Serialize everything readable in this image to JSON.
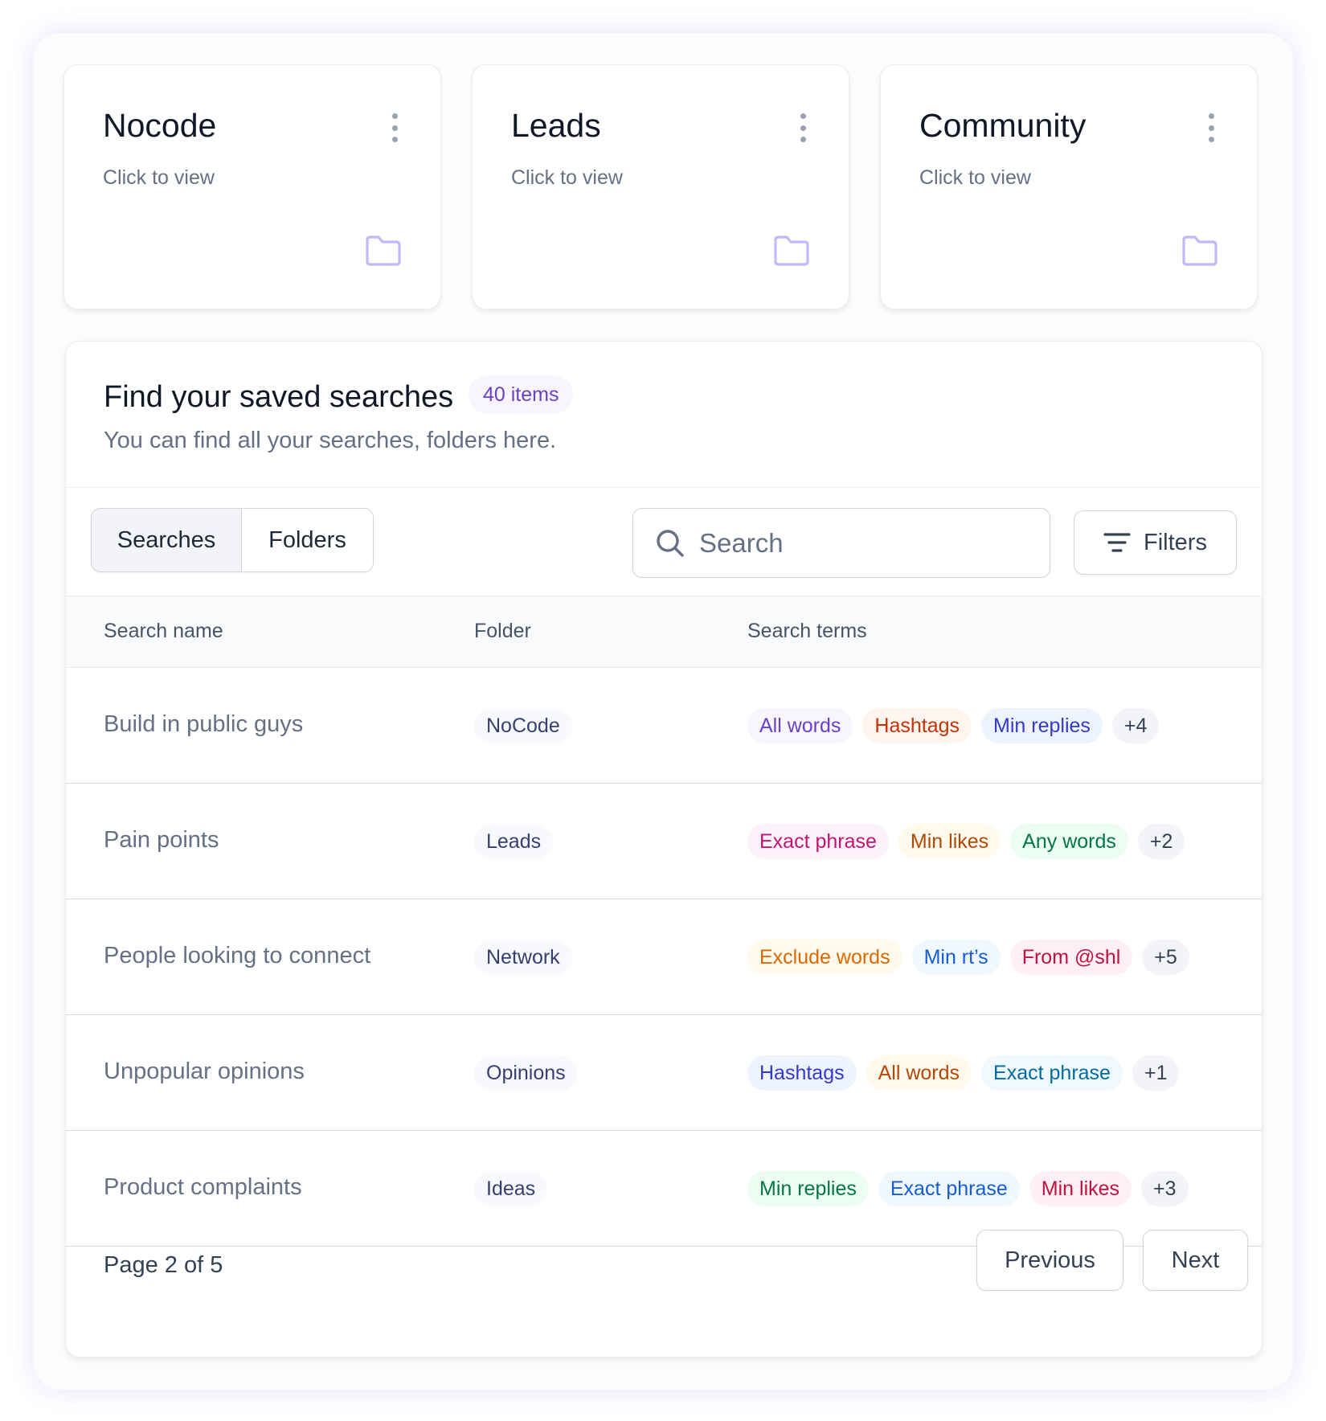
{
  "folders": [
    {
      "title": "Nocode",
      "subtitle": "Click to view"
    },
    {
      "title": "Leads",
      "subtitle": "Click to view"
    },
    {
      "title": "Community",
      "subtitle": "Click to view"
    }
  ],
  "saved": {
    "title": "Find your saved searches",
    "count_badge": "40 items",
    "subtitle": "You can find all your searches, folders here."
  },
  "toolbar": {
    "tabs": [
      "Searches",
      "Folders"
    ],
    "active_tab": "Searches",
    "search_placeholder": "Search",
    "search_value": "",
    "filters_label": "Filters"
  },
  "table": {
    "columns": [
      "Search name",
      "Folder",
      "Search terms"
    ],
    "rows": [
      {
        "name": "Build in public guys",
        "folder": "NoCode",
        "terms": [
          "All words",
          "Hashtags",
          "Min replies"
        ],
        "more": "+4"
      },
      {
        "name": "Pain points",
        "folder": "Leads",
        "terms": [
          "Exact phrase",
          "Min likes",
          "Any words"
        ],
        "more": "+2"
      },
      {
        "name": "People looking to connect",
        "folder": "Network",
        "terms": [
          "Exclude words",
          "Min rt’s",
          "From @shl"
        ],
        "more": "+5"
      },
      {
        "name": "Unpopular opinions",
        "folder": "Opinions",
        "terms": [
          "Hashtags",
          "All words",
          "Exact phrase"
        ],
        "more": "+1"
      },
      {
        "name": "Product complaints",
        "folder": "Ideas",
        "terms": [
          "Min replies",
          "Exact phrase",
          "Min likes"
        ],
        "more": "+3"
      }
    ]
  },
  "pagination": {
    "page_info": "Page 2 of 5",
    "previous_label": "Previous",
    "next_label": "Next"
  },
  "icons": {
    "folder": "folder-icon",
    "menu": "more-vertical-icon",
    "search": "search-icon",
    "filters": "filter-lines-icon"
  },
  "colors": {
    "accent": "#6941c6",
    "folder_icon": "#c4b5fd"
  }
}
